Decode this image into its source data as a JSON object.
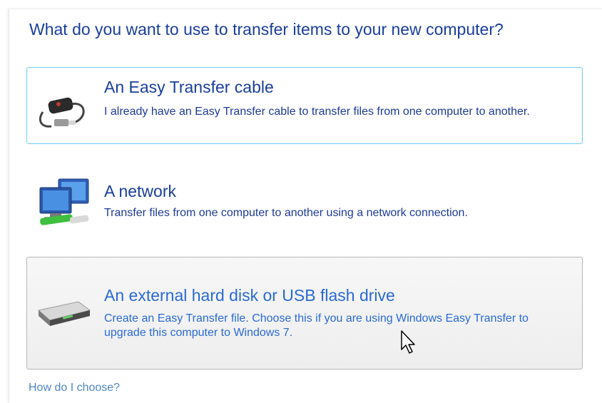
{
  "question": "What do you want to use to transfer items to your new computer?",
  "options": [
    {
      "title": "An Easy Transfer cable",
      "description": "I already have an Easy Transfer cable to transfer files from one computer to another.",
      "icon": "usb-cable-icon"
    },
    {
      "title": "A network",
      "description": "Transfer files from one computer to another using a network connection.",
      "icon": "network-computers-icon"
    },
    {
      "title": "An external hard disk or USB flash drive",
      "description": "Create an Easy Transfer file. Choose this if you are using Windows Easy Transfer to upgrade this computer to Windows 7.",
      "icon": "external-drive-icon"
    }
  ],
  "help_link": "How do I choose?",
  "colors": {
    "heading": "#1a3e9c",
    "hover_text": "#2a6ad6",
    "link": "#4f86c9",
    "selected_border": "#7fd0f2"
  }
}
